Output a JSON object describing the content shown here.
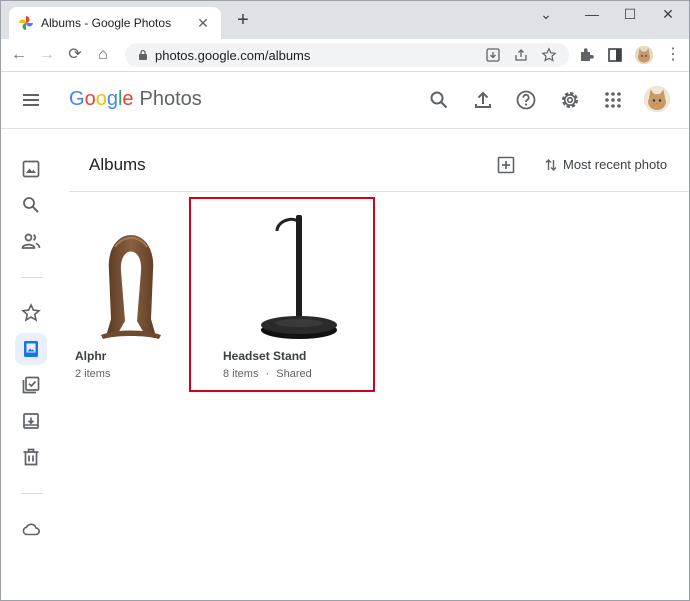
{
  "browser": {
    "tab_title": "Albums - Google Photos",
    "tab_close": "✕",
    "new_tab": "+",
    "window_controls": {
      "collapse": "⌄",
      "minimize": "—",
      "maximize": "☐",
      "close": "✕"
    },
    "nav": {
      "back": "←",
      "forward": "→",
      "reload": "⟳",
      "home": "⌂"
    },
    "url": "photos.google.com/albums",
    "menu": "⋮"
  },
  "app": {
    "logo_google": [
      "G",
      "o",
      "o",
      "g",
      "l",
      "e"
    ],
    "logo_product": "Photos",
    "page_title": "Albums",
    "sort_label": "Most recent photo"
  },
  "albums": [
    {
      "name": "Alphr",
      "items": "2 items",
      "shared": ""
    },
    {
      "name": "Headset Stand",
      "items": "8 items",
      "separator": "·",
      "shared": "Shared"
    }
  ],
  "colors": {
    "highlight": "#d0021b",
    "accent_blue": "#1a73e8",
    "active_nav_bg": "#e8f0fe"
  },
  "icons": {
    "header": [
      "search-icon",
      "upload-icon",
      "help-icon",
      "settings-icon",
      "apps-icon"
    ],
    "rail": [
      "photos-icon",
      "explore-icon",
      "sharing-icon",
      "favorites-icon",
      "albums-icon",
      "utilities-icon",
      "archive-icon",
      "trash-icon",
      "storage-icon"
    ]
  }
}
